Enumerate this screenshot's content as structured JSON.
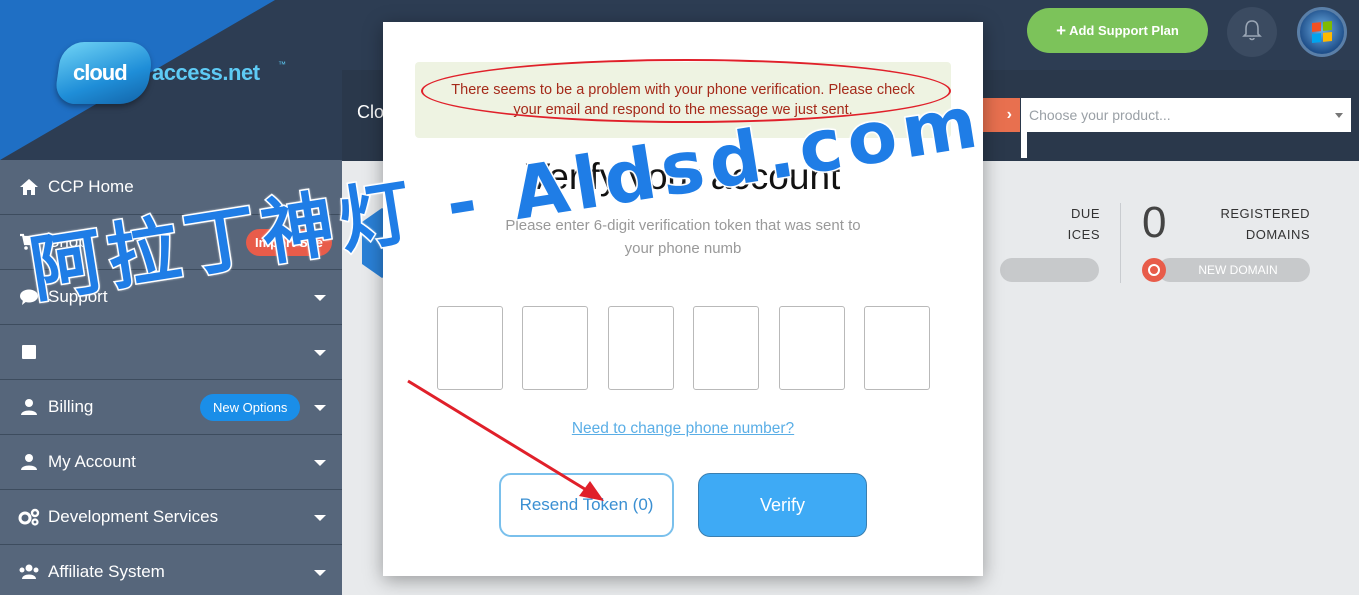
{
  "brand": {
    "logo_part1": "cloud",
    "logo_part2": "access.net",
    "logo_tm": "™"
  },
  "header": {
    "add_support_plan": "Add Support Plan",
    "bell_icon": "bell-icon",
    "avatar_icon": "windows-logo"
  },
  "sidebar": {
    "items": [
      {
        "label": "CCP Home",
        "icon": "home-icon"
      },
      {
        "label": "Shop",
        "icon": "cart-icon",
        "badge": "Import Site"
      },
      {
        "label": "Support",
        "icon": "chat-bubble-icon"
      },
      {
        "label": "",
        "icon": "book-icon"
      },
      {
        "label": "Billing",
        "icon": "user-icon",
        "badge": "New Options"
      },
      {
        "label": "My Account",
        "icon": "user-icon"
      },
      {
        "label": "Development Services",
        "icon": "gears-icon"
      },
      {
        "label": "Affiliate System",
        "icon": "users-icon"
      }
    ]
  },
  "subbar": {
    "truncated_text": "Clo",
    "product_placeholder": "Choose your product..."
  },
  "stats": {
    "due_label_1": "DUE",
    "due_label_2": "ICES",
    "domains_count": "0",
    "domains_label_1": "REGISTERED",
    "domains_label_2": "DOMAINS",
    "new_domain_btn": "NEW DOMAIN"
  },
  "modal": {
    "alert": "There seems to be a problem with your phone verification. Please check your email and respond to the message we just sent.",
    "title": "Verify your account",
    "subtitle": "Please enter 6-digit verification token that was sent to your phone numb",
    "token_boxes": [
      "",
      "",
      "",
      "",
      "",
      ""
    ],
    "change_phone_link": "Need to change phone number?",
    "resend_button": "Resend Token (0)",
    "verify_button": "Verify"
  },
  "watermark": "阿拉丁神灯 - Aldsd.com",
  "colors": {
    "sidebar_bg": "#56667b",
    "header_bg": "#2d3d53",
    "green_btn": "#7cc35a",
    "accent_blue": "#3eaaf5",
    "alert_text": "#a52a1a",
    "annotation_red": "#e0202a"
  }
}
